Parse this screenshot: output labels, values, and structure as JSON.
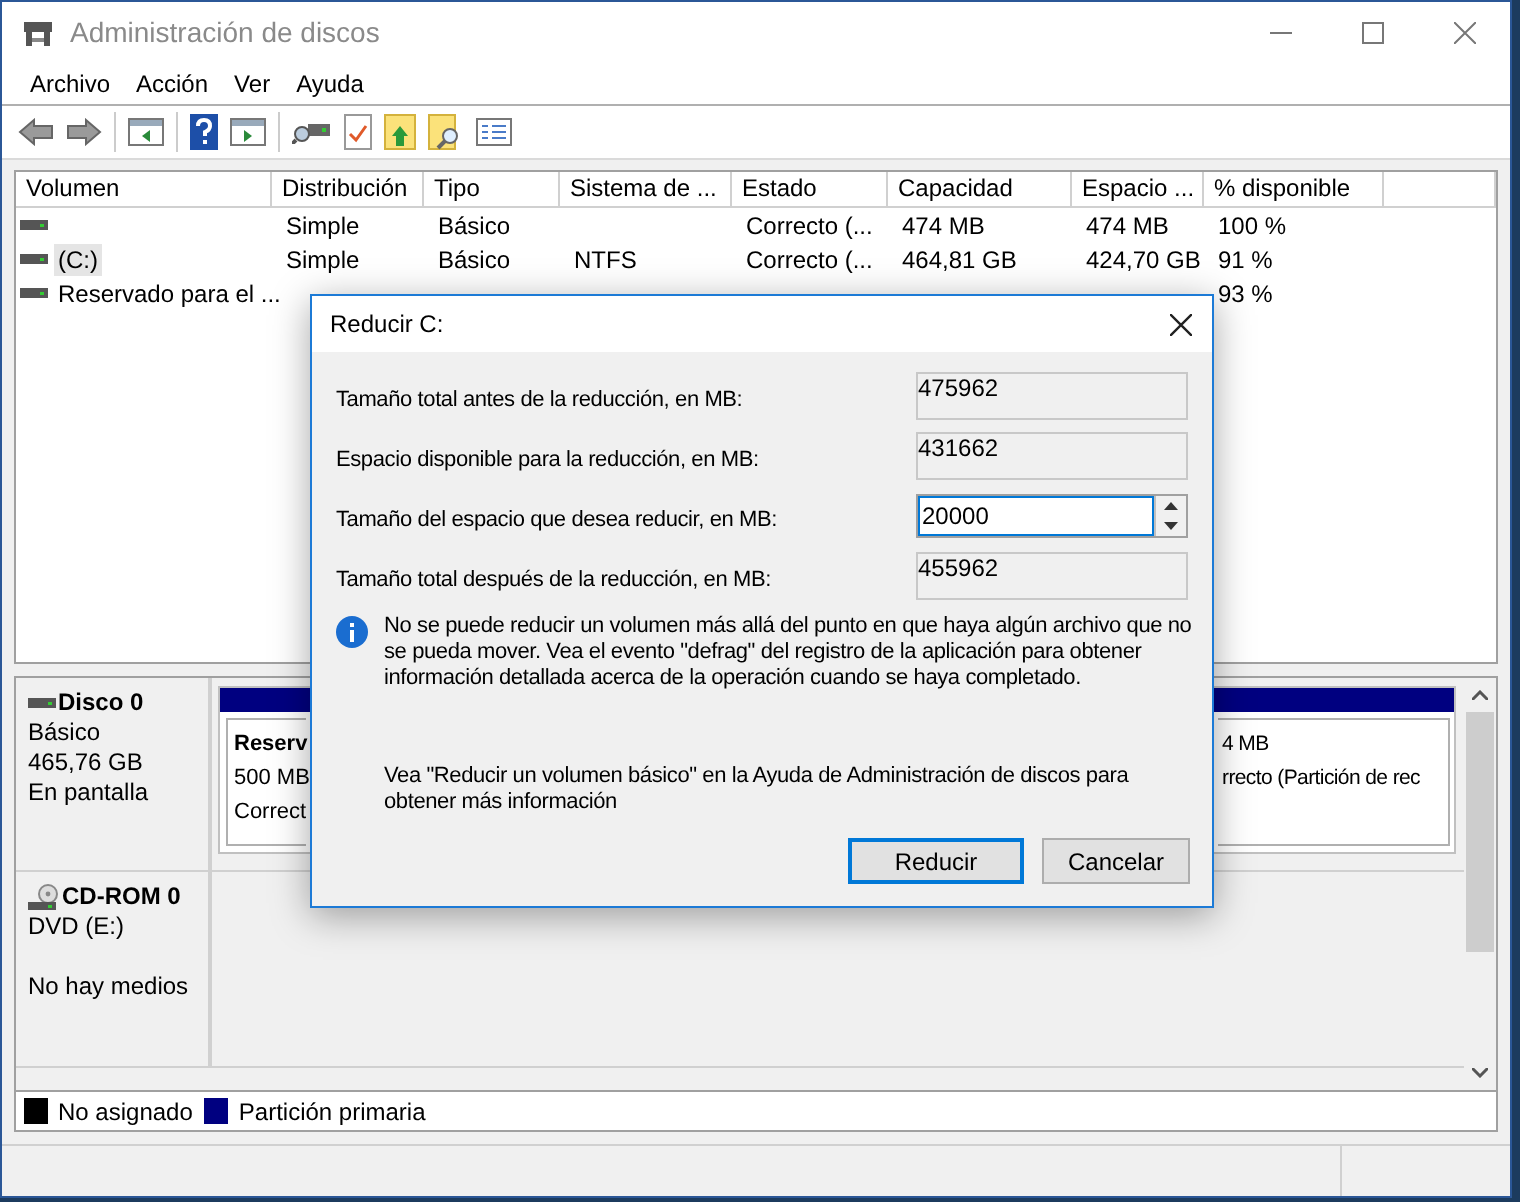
{
  "window": {
    "title": "Administración de discos"
  },
  "menu": [
    "Archivo",
    "Acción",
    "Ver",
    "Ayuda"
  ],
  "table": {
    "columns": [
      "Volumen",
      "Distribución",
      "Tipo",
      "Sistema de ...",
      "Estado",
      "Capacidad",
      "Espacio ...",
      "% disponible"
    ],
    "rows": [
      {
        "selected": false,
        "cells": [
          null,
          "Simple",
          "Básico",
          null,
          "Correcto (...",
          "474 MB",
          "474 MB",
          "100 %"
        ]
      },
      {
        "selected": true,
        "cells": [
          "(C:)",
          "Simple",
          "Básico",
          "NTFS",
          "Correcto (...",
          "464,81 GB",
          "424,70 GB",
          "91 %"
        ]
      },
      {
        "selected": false,
        "cells": [
          "Reservado para el ...",
          null,
          null,
          null,
          null,
          null,
          null,
          "93 %"
        ]
      }
    ]
  },
  "disks": [
    {
      "kind": "disk",
      "name": "Disco 0",
      "details": [
        "Básico",
        "465,76 GB",
        "En pantalla"
      ],
      "partitions": [
        {
          "title": "Reserv",
          "size": "500 MB",
          "status": "Correct"
        },
        {
          "size": "4 MB",
          "status": "rrecto (Partición de rec"
        }
      ]
    },
    {
      "kind": "cdrom",
      "name": "CD-ROM 0",
      "details": [
        "DVD (E:)"
      ],
      "media": "No hay medios"
    }
  ],
  "legend": [
    {
      "label": "No asignado",
      "color": "#000000"
    },
    {
      "label": "Partición primaria",
      "color": "#000080"
    }
  ],
  "dialog": {
    "title": "Reducir C:",
    "fields": [
      {
        "kind": "readonly",
        "label": "Tamaño total antes de la reducción, en MB:",
        "value": "475962"
      },
      {
        "kind": "readonly",
        "label": "Espacio disponible para la reducción, en MB:",
        "value": "431662"
      },
      {
        "kind": "spin",
        "label": "Tamaño del espacio que desea reducir, en MB:",
        "value": "20000"
      },
      {
        "kind": "readonly",
        "label": "Tamaño total después de la reducción, en MB:",
        "value": "455962"
      }
    ],
    "info": "No se puede reducir un volumen más allá del punto en que haya algún archivo que no se pueda mover. Vea el evento \"defrag\" del registro de la aplicación para obtener información detallada acerca de la operación cuando se haya completado.",
    "help": "Vea \"Reducir un volumen básico\"  en la Ayuda de Administración de discos para obtener más información",
    "buttons": [
      {
        "label": "Reducir",
        "default": true
      },
      {
        "label": "Cancelar",
        "default": false
      }
    ]
  }
}
